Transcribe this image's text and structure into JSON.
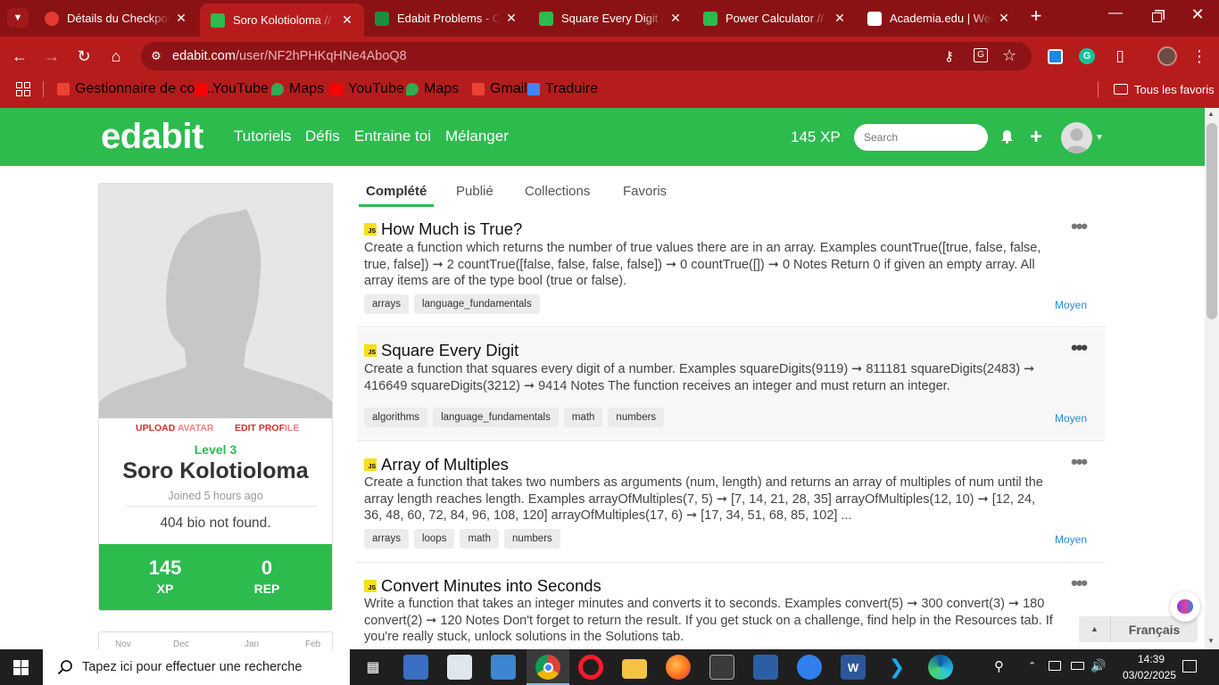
{
  "browser": {
    "tabs": [
      {
        "title": "Détails du Checkpoint",
        "active": false,
        "favicon_color": "#e53935"
      },
      {
        "title": "Soro Kolotioloma // Edabit",
        "active": true,
        "favicon_color": "#2dbb4e"
      },
      {
        "title": "Edabit Problems - Google Sheets",
        "active": false,
        "favicon_color": "#1e8e3e"
      },
      {
        "title": "Square Every Digit // Edabit",
        "active": false,
        "favicon_color": "#2dbb4e"
      },
      {
        "title": "Power Calculator // Edabit",
        "active": false,
        "favicon_color": "#2dbb4e"
      },
      {
        "title": "Academia.edu | Welcome",
        "active": false,
        "favicon_color": "#ffffff"
      }
    ],
    "url_domain": "edabit.com",
    "url_path": "/user/NF2hPHKqHNe4AboQ8",
    "bookmarks": [
      {
        "label": "Gestionnaire de con...",
        "icon": "gmail-icon"
      },
      {
        "label": "YouTube",
        "icon": "youtube-icon"
      },
      {
        "label": "Maps",
        "icon": "maps-icon"
      },
      {
        "label": "YouTube",
        "icon": "youtube-icon"
      },
      {
        "label": "Maps",
        "icon": "maps-icon"
      },
      {
        "label": "Gmail",
        "icon": "gmail-icon"
      },
      {
        "label": "Traduire",
        "icon": "translate-icon"
      }
    ],
    "all_bookmarks": "Tous les favoris",
    "accent": "#b71c1c"
  },
  "nav": {
    "logo": "edabit",
    "links": [
      "Tutoriels",
      "Défis",
      "Entraine toi",
      "Mélanger"
    ],
    "xp": "145 XP",
    "search_placeholder": "Search",
    "brand_color": "#2dbb4e"
  },
  "profile": {
    "upload_avatar_1": "UPLOAD",
    "upload_avatar_2": "AVATAR",
    "edit_profile_1": "EDIT PROF",
    "edit_profile_2": "ILE",
    "level": "Level 3",
    "name": "Soro Kolotioloma",
    "joined": "Joined 5 hours ago",
    "bio": "404 bio not found.",
    "xp_value": "145",
    "xp_label": "XP",
    "rep_value": "0",
    "rep_label": "REP",
    "months": [
      "Nov",
      "Dec",
      "Jan",
      "Feb"
    ]
  },
  "tabs": [
    "Complété",
    "Publié",
    "Collections",
    "Favoris"
  ],
  "challenges": [
    {
      "title": "How Much is True?",
      "description": "Create a function which returns the number of true values there are in an array. Examples countTrue([true, false, false, true, false]) ➞ 2 countTrue([false, false, false, false]) ➞ 0 countTrue([]) ➞ 0 Notes Return 0 if given an empty array. All array items are of the type bool (true or false).",
      "tags": [
        "arrays",
        "language_fundamentals"
      ],
      "difficulty": "Moyen"
    },
    {
      "title": "Square Every Digit",
      "description": "Create a function that squares every digit of a number. Examples squareDigits(9119) ➞ 811181 squareDigits(2483) ➞ 416649 squareDigits(3212) ➞ 9414 Notes The function receives an integer and must return an integer.",
      "tags": [
        "algorithms",
        "language_fundamentals",
        "math",
        "numbers"
      ],
      "difficulty": "Moyen"
    },
    {
      "title": "Array of Multiples",
      "description": "Create a function that takes two numbers as arguments (num, length) and returns an array of multiples of num until the array length reaches length. Examples arrayOfMultiples(7, 5) ➞ [7, 14, 21, 28, 35] arrayOfMultiples(12, 10) ➞ [12, 24, 36, 48, 60, 72, 84, 96, 108, 120] arrayOfMultiples(17, 6) ➞ [17, 34, 51, 68, 85, 102] ...",
      "tags": [
        "arrays",
        "loops",
        "math",
        "numbers"
      ],
      "difficulty": "Moyen"
    },
    {
      "title": "Convert Minutes into Seconds",
      "description": "Write a function that takes an integer minutes and converts it to seconds. Examples convert(5) ➞ 300 convert(3) ➞ 180 convert(2) ➞ 120 Notes Don't forget to return the result. If you get stuck on a challenge, find help in the Resources tab. If you're really stuck, unlock solutions in the Solutions tab.",
      "tags": [],
      "difficulty": ""
    }
  ],
  "language_widget": "Français",
  "taskbar": {
    "search_placeholder": "Tapez ici pour effectuer une recherche",
    "time": "14:39",
    "date": "03/02/2025"
  }
}
